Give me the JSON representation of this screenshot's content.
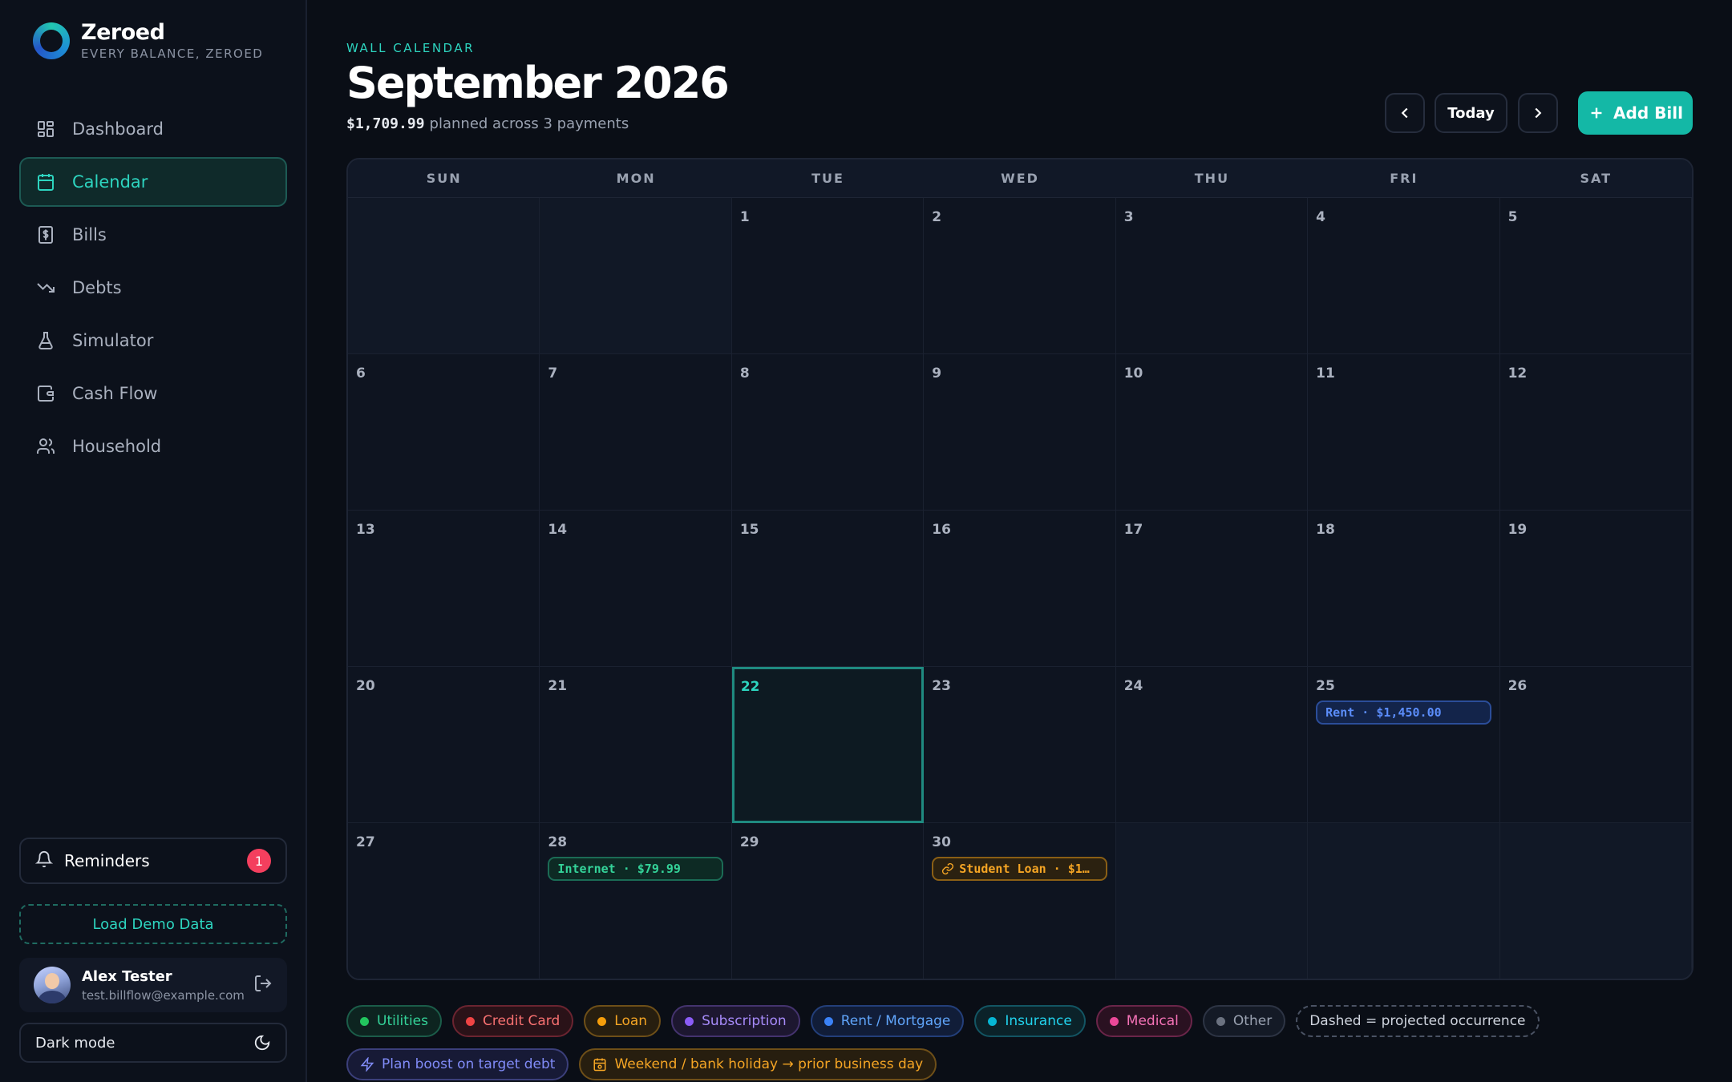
{
  "brand": {
    "name": "Zeroed",
    "tagline": "EVERY BALANCE, ZEROED"
  },
  "nav": {
    "items": [
      {
        "label": "Dashboard",
        "icon": "grid-icon"
      },
      {
        "label": "Calendar",
        "icon": "calendar-icon",
        "active": true
      },
      {
        "label": "Bills",
        "icon": "dollar-doc-icon"
      },
      {
        "label": "Debts",
        "icon": "trending-down-icon"
      },
      {
        "label": "Simulator",
        "icon": "flask-icon"
      },
      {
        "label": "Cash Flow",
        "icon": "wallet-icon"
      },
      {
        "label": "Household",
        "icon": "users-icon"
      }
    ]
  },
  "sidebar_footer": {
    "reminders_label": "Reminders",
    "reminders_count": "1",
    "load_demo_label": "Load Demo Data",
    "user_name": "Alex Tester",
    "user_email": "test.billflow@example.com",
    "dark_mode_label": "Dark mode"
  },
  "header": {
    "eyebrow": "WALL CALENDAR",
    "title": "September 2026",
    "planned_amount": "$1,709.99",
    "planned_text": "planned across 3 payments",
    "today_label": "Today",
    "add_bill_label": "Add Bill"
  },
  "calendar": {
    "weekdays": [
      "SUN",
      "MON",
      "TUE",
      "WED",
      "THU",
      "FRI",
      "SAT"
    ],
    "today": "22",
    "cells": [
      {
        "day": "",
        "muted": true
      },
      {
        "day": "",
        "muted": true
      },
      {
        "day": "1"
      },
      {
        "day": "2"
      },
      {
        "day": "3"
      },
      {
        "day": "4"
      },
      {
        "day": "5"
      },
      {
        "day": "6"
      },
      {
        "day": "7"
      },
      {
        "day": "8"
      },
      {
        "day": "9"
      },
      {
        "day": "10"
      },
      {
        "day": "11"
      },
      {
        "day": "12"
      },
      {
        "day": "13"
      },
      {
        "day": "14"
      },
      {
        "day": "15"
      },
      {
        "day": "16"
      },
      {
        "day": "17"
      },
      {
        "day": "18"
      },
      {
        "day": "19"
      },
      {
        "day": "20"
      },
      {
        "day": "21"
      },
      {
        "day": "22",
        "today": true
      },
      {
        "day": "23"
      },
      {
        "day": "24"
      },
      {
        "day": "25",
        "event": {
          "label": "Rent · $1,450.00",
          "category": "rent"
        }
      },
      {
        "day": "26"
      },
      {
        "day": "27"
      },
      {
        "day": "28",
        "event": {
          "label": "Internet · $79.99",
          "category": "utilities"
        }
      },
      {
        "day": "29"
      },
      {
        "day": "30",
        "event": {
          "label": "Student Loan · $1…",
          "category": "loan",
          "icon": "link-icon"
        }
      },
      {
        "day": "",
        "muted": true
      },
      {
        "day": "",
        "muted": true
      },
      {
        "day": "",
        "muted": true
      }
    ]
  },
  "legend": {
    "categories": [
      {
        "label": "Utilities",
        "cls": "c-util"
      },
      {
        "label": "Credit Card",
        "cls": "c-cc"
      },
      {
        "label": "Loan",
        "cls": "c-loan"
      },
      {
        "label": "Subscription",
        "cls": "c-sub"
      },
      {
        "label": "Rent / Mortgage",
        "cls": "c-rent"
      },
      {
        "label": "Insurance",
        "cls": "c-ins"
      },
      {
        "label": "Medical",
        "cls": "c-med"
      },
      {
        "label": "Other",
        "cls": "c-other"
      }
    ],
    "dashed_note": "Dashed = projected occurrence",
    "boost_note": "Plan boost on target debt",
    "holiday_note": "Weekend / bank holiday → prior business day"
  },
  "colors": {
    "accent": "#14b8a6",
    "background": "#0a0e16",
    "sidebar": "#0c111b"
  }
}
